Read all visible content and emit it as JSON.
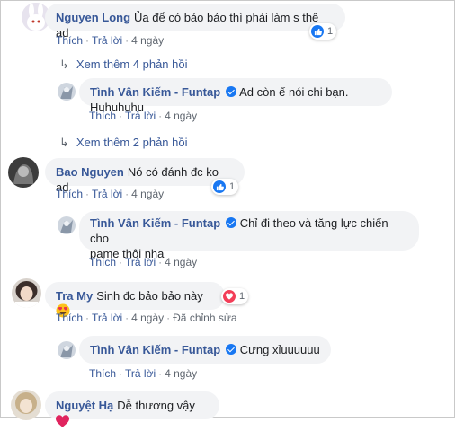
{
  "comments": [
    {
      "author": "Nguyen Long",
      "text": "Ủa để có bảo bảo thì phải làm s thế ad",
      "actions": [
        "Thích",
        "Trả lời",
        "4 ngày"
      ],
      "reaction_count": "1",
      "reaction_type": "like-icon",
      "view_more": "Xem thêm 4 phản hồi",
      "reply": {
        "author": "Tình Vân Kiếm - Funtap",
        "text": "Ad còn ế nói chi bạn. Huhuhuhu",
        "actions": [
          "Thích",
          "Trả lời",
          "4 ngày"
        ]
      },
      "view_more_after": "Xem thêm 2 phản hồi"
    },
    {
      "author": "Bao Nguyen",
      "text": "Nó có đánh đc ko ad",
      "actions": [
        "Thích",
        "Trả lời",
        "4 ngày"
      ],
      "reaction_count": "1",
      "reaction_type": "like-icon",
      "reply": {
        "author": "Tình Vân Kiếm - Funtap",
        "text_line1": "Chỉ đi theo và tăng lực chiến cho",
        "text_line2": "pame thôi nha",
        "actions": [
          "Thích",
          "Trả lời",
          "4 ngày"
        ]
      }
    },
    {
      "author": "Tra My",
      "text": "Sinh đc bảo bảo này",
      "actions": [
        "Thích",
        "Trả lời",
        "4 ngày",
        "Đã chỉnh sửa"
      ],
      "reaction_count": "1",
      "reaction_type": "heart-icon",
      "reply": {
        "author": "Tình Vân Kiếm - Funtap",
        "text": "Cưng xỉuuuuuu",
        "actions": [
          "Thích",
          "Trả lời",
          "4 ngày"
        ]
      }
    },
    {
      "author": "Nguyệt Hạ",
      "text": "Dễ thương vậy"
    }
  ],
  "colors": {
    "link": "#385898",
    "bubble": "#f2f3f5",
    "like": "#1877f2",
    "love": "#f33e58"
  }
}
